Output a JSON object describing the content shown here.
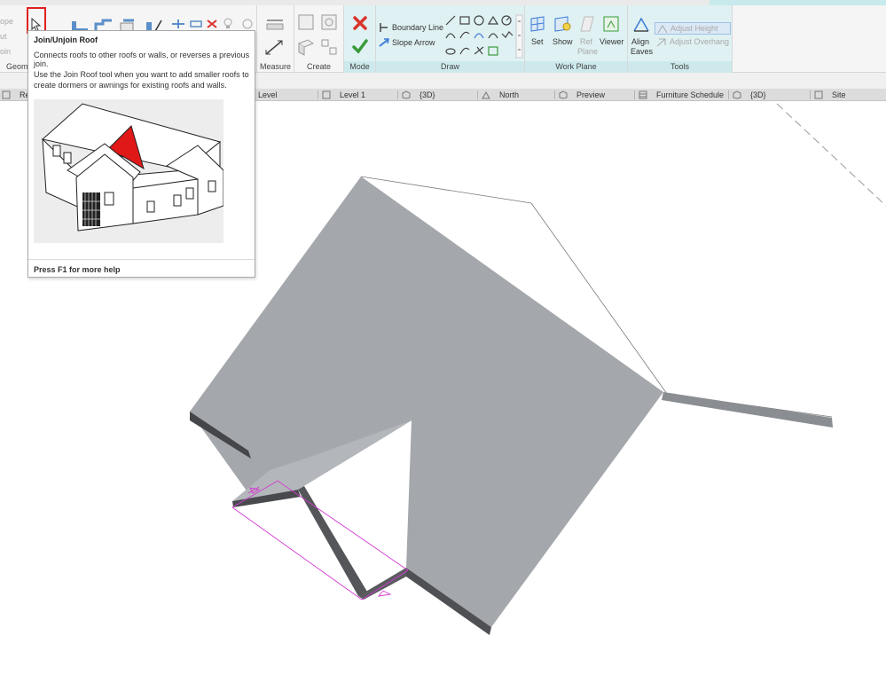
{
  "ribbon": {
    "left_fragments": {
      "a": "ope",
      "b": "ut",
      "c": "oin"
    },
    "panels": {
      "geometry": "Geome",
      "measure": "Measure",
      "create": "Create",
      "mode": "Mode",
      "draw": "Draw",
      "work_plane": "Work Plane",
      "tools": "Tools"
    },
    "draw": {
      "boundary_line": "Boundary Line",
      "slope_arrow": "Slope Arrow"
    },
    "work_plane": {
      "set": "Set",
      "show": "Show",
      "ref_plane_1": "Ref",
      "ref_plane_2": "Plane",
      "viewer": "Viewer"
    },
    "tools": {
      "align_1": "Align",
      "align_2": "Eaves",
      "adjust_height": "Adjust Height",
      "adjust_overhang": "Adjust Overhang"
    }
  },
  "view_tabs": [
    {
      "label": "Ref. L"
    },
    {
      "label": "Ref. Level"
    },
    {
      "label": "Level 1"
    },
    {
      "label": "{3D}"
    },
    {
      "label": "North"
    },
    {
      "label": "Preview"
    },
    {
      "label": "Furniture Schedule"
    },
    {
      "label": "{3D}"
    },
    {
      "label": "Site"
    }
  ],
  "tooltip": {
    "title": "Join/Unjoin Roof",
    "description": "Connects roofs to other roofs or walls, or reverses a previous join.",
    "long_description": "Use the Join Roof tool when you want to add smaller roofs to create dormers or awnings for existing roofs and walls.",
    "footer": "Press F1 for more help"
  },
  "colors": {
    "roof_fill": "#a4a7ab",
    "roof_edge": "#4f5054",
    "sketch_lines": "#d23cd2",
    "highlight": "#e02020",
    "mode_cancel": "#d9342b",
    "mode_finish": "#3a9a3a",
    "contextual_tab": "#dff1f3"
  }
}
